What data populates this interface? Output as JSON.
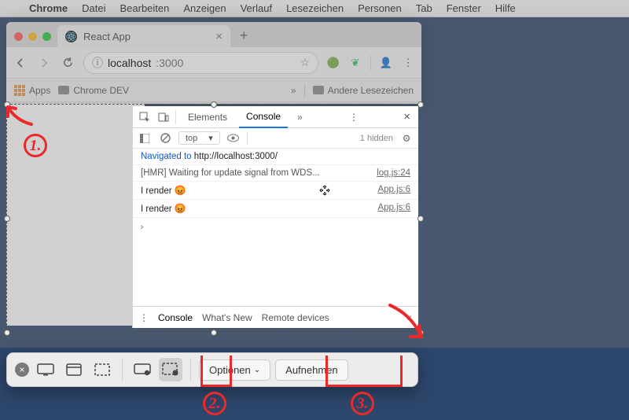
{
  "menubar": {
    "app": "Chrome",
    "items": [
      "Datei",
      "Bearbeiten",
      "Anzeigen",
      "Verlauf",
      "Lesezeichen",
      "Personen",
      "Tab",
      "Fenster",
      "Hilfe"
    ]
  },
  "browser": {
    "tab_title": "React App",
    "address_host": "localhost",
    "address_port": ":3000",
    "bookmarks": {
      "apps": "Apps",
      "folder1": "Chrome DEV",
      "other": "Andere Lesezeichen"
    }
  },
  "devtools": {
    "tabs": {
      "elements": "Elements",
      "console": "Console"
    },
    "context": "top",
    "hidden": "1 hidden",
    "log": {
      "nav_prefix": "Navigated to ",
      "nav_url": "http://localhost:3000/",
      "hmr_msg": "[HMR] Waiting for update signal from WDS...",
      "hmr_src": "log.js:24",
      "render_msg": "I render",
      "render_src": "App.js:6"
    },
    "drawer": {
      "console": "Console",
      "whatsnew": "What's New",
      "remote": "Remote devices"
    }
  },
  "shotbar": {
    "options": "Optionen",
    "capture": "Aufnehmen"
  },
  "annotations": {
    "n1": "1.",
    "n2": "2.",
    "n3": "3."
  }
}
